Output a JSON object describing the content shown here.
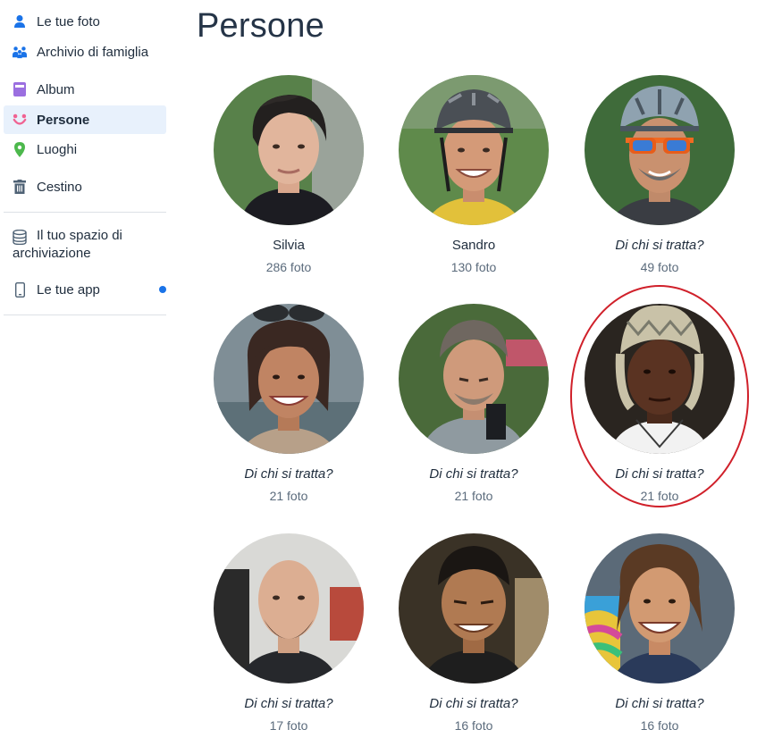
{
  "sidebar": {
    "items": [
      {
        "label": "Le tue foto",
        "icon": "person-icon"
      },
      {
        "label": "Archivio di famiglia",
        "icon": "family-icon"
      },
      {
        "label": "Album",
        "icon": "album-icon"
      },
      {
        "label": "Persone",
        "icon": "smiley-icon",
        "active": true
      },
      {
        "label": "Luoghi",
        "icon": "location-pin-icon"
      },
      {
        "label": "Cestino",
        "icon": "trash-icon"
      },
      {
        "label": "Il tuo spazio di archiviazione",
        "icon": "storage-icon"
      },
      {
        "label": "Le tue app",
        "icon": "phone-icon",
        "badge": "notification-dot"
      }
    ]
  },
  "main": {
    "title": "Persone",
    "people": [
      {
        "name": "Silvia",
        "count": "286 foto",
        "named": true
      },
      {
        "name": "Sandro",
        "count": "130 foto",
        "named": true
      },
      {
        "name": "Di chi si tratta?",
        "count": "49 foto",
        "named": false
      },
      {
        "name": "Di chi si tratta?",
        "count": "21 foto",
        "named": false
      },
      {
        "name": "Di chi si tratta?",
        "count": "21 foto",
        "named": false
      },
      {
        "name": "Di chi si tratta?",
        "count": "21 foto",
        "named": false,
        "highlighted": true
      },
      {
        "name": "Di chi si tratta?",
        "count": "17 foto",
        "named": false
      },
      {
        "name": "Di chi si tratta?",
        "count": "16 foto",
        "named": false
      },
      {
        "name": "Di chi si tratta?",
        "count": "16 foto",
        "named": false
      }
    ]
  },
  "colors": {
    "accent": "#1a73e8",
    "active_bg": "#e8f1fc",
    "highlight_ring": "#d0202a",
    "count_text": "#5b6b7c"
  }
}
